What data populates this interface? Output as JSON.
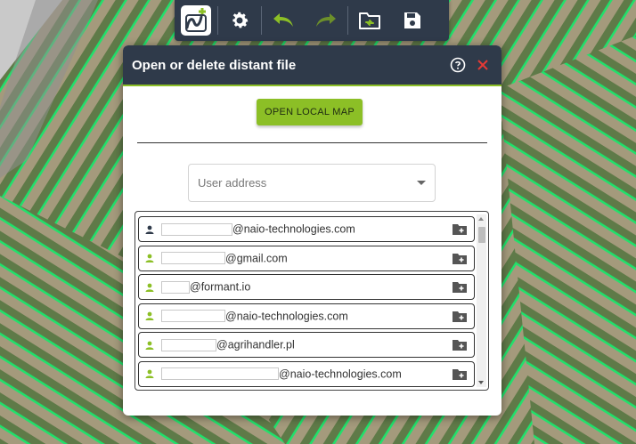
{
  "toolbar": {
    "logo_icon": "map-plus-icon",
    "settings_icon": "gear-icon",
    "undo_icon": "undo-icon",
    "redo_icon": "redo-icon",
    "open_icon": "folder-sync-icon",
    "save_icon": "floppy-disk-icon"
  },
  "dialog": {
    "title": "Open or delete distant file",
    "help_icon": "help-circle-icon",
    "close_icon": "close-icon",
    "open_local_label": "OPEN LOCAL MAP",
    "user_address_placeholder": "User address"
  },
  "users": [
    {
      "prefix_redacted": true,
      "email": "@naio-technologies.com",
      "icon": "user-icon",
      "icon_color": "#2f3a4a"
    },
    {
      "prefix_redacted": true,
      "email": "@gmail.com",
      "icon": "user-icon",
      "icon_color": "#8cbf26"
    },
    {
      "prefix_redacted": true,
      "email": "@formant.io",
      "icon": "user-icon",
      "icon_color": "#8cbf26"
    },
    {
      "prefix_redacted": true,
      "email": "@naio-technologies.com",
      "icon": "user-icon",
      "icon_color": "#8cbf26"
    },
    {
      "prefix_redacted": true,
      "email": "@agrihandler.pl",
      "icon": "user-icon",
      "icon_color": "#8cbf26"
    },
    {
      "prefix_redacted": true,
      "email": "@naio-technologies.com",
      "icon": "user-icon",
      "icon_color": "#8cbf26"
    }
  ],
  "colors": {
    "accent": "#8cbf26",
    "header": "#2f3a4a",
    "close": "#e53935"
  }
}
